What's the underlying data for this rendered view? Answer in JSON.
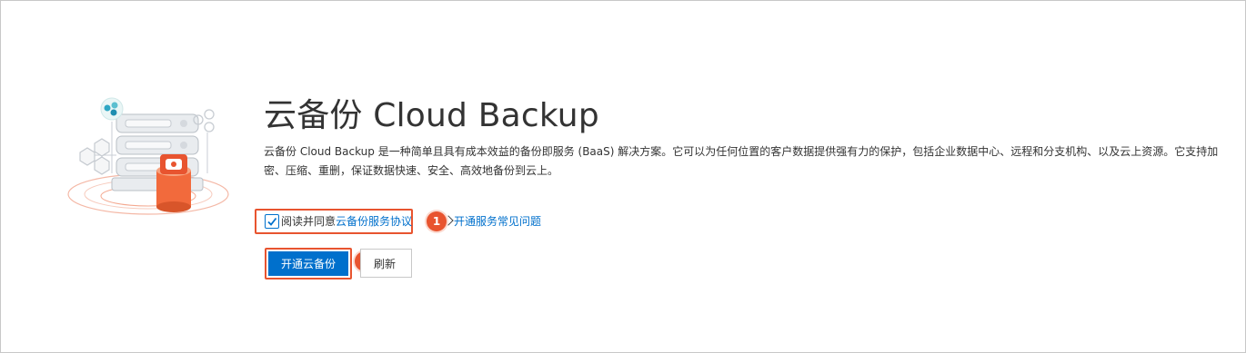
{
  "product": {
    "title": "云备份 Cloud Backup",
    "description": "云备份 Cloud Backup 是一种简单且具有成本效益的备份即服务 (BaaS) 解决方案。它可以为任何位置的客户数据提供强有力的保护，包括企业数据中心、远程和分支机构、以及云上资源。它支持加密、压缩、重删，保证数据快速、安全、高效地备份到云上。"
  },
  "agreement": {
    "checked": true,
    "prefix": "阅读并同意",
    "link_label": "云备份服务协议"
  },
  "faq": {
    "label": "开通服务常见问题"
  },
  "buttons": {
    "activate_label": "开通云备份",
    "refresh_label": "刷新"
  },
  "annotations": {
    "step1": "1",
    "step2": "2"
  },
  "colors": {
    "accent": "#0070cc",
    "highlight": "#e8542f"
  }
}
